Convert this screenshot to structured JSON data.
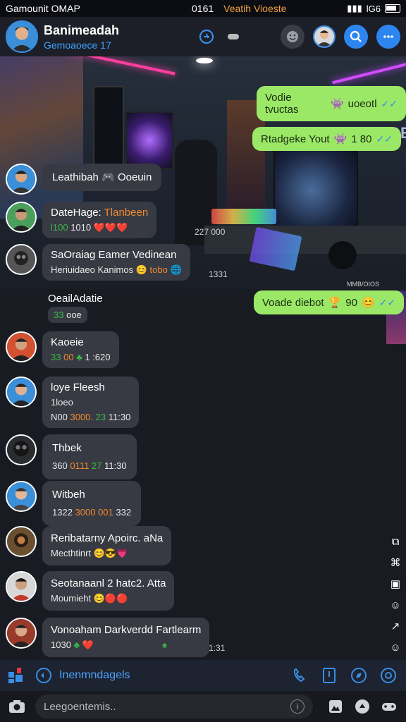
{
  "status_bar": {
    "carrier": "Gamounit OMAP",
    "time": "0161",
    "center_text": "Veatih Vioeste",
    "right_text": "lG6"
  },
  "header": {
    "name": "Banimeadah",
    "subtitle": "Gemoaoece 17"
  },
  "incoming": [
    {
      "title": "Leathibah",
      "title_tail": "Ooeuin",
      "line2": ""
    },
    {
      "title": "DateHage:",
      "title_tail": "Tlanbeen",
      "line2": "l​100",
      "line2_b": "1010",
      "ts": "227 000"
    },
    {
      "title": "SaOraiag Eamer Vedinean",
      "line2": "Heriuidaeo Kanimos",
      "line2_b": "tobo",
      "ts": "1331"
    },
    {
      "title": "OeailAdatie",
      "line2": "33",
      "line2_b": "ooe"
    },
    {
      "title": "Kaoeie",
      "line2": "33",
      "line2_b": "00",
      "line2_c": "1 :620"
    },
    {
      "title": "loye Fleesh",
      "line2": "1loeo",
      "line3": "N00",
      "line3_b": "3000.",
      "line3_c": "23",
      "line3_d": "11:30"
    },
    {
      "title": "Thbek",
      "line2": "360",
      "line2_b": "0111",
      "line2_c": "27",
      "line2_d": "11:30"
    },
    {
      "title": "Witbeh",
      "line2": "1322",
      "line2_b": "3000 001",
      "line2_c": "332"
    },
    {
      "title": "Reribatarny Apoirc. aNa",
      "line2": "Mecthtinrt"
    },
    {
      "title": "Seotanaanl 2 hatc2. Atta",
      "line2": "Moumieht"
    },
    {
      "title": "Vonoaham Darkverdd Fartlearm",
      "line2": "1030",
      "ts": "1:31"
    }
  ],
  "outgoing": [
    {
      "text": "Vodie tvuctas",
      "tail": "uoeotl"
    },
    {
      "text": "Rtadgeke Yout",
      "tail": "1 80"
    },
    {
      "text": "Voade diebot",
      "tail": "90"
    }
  ],
  "scene_tag": "IDE",
  "watermark": "MMB/OIOS",
  "bottom_label": "Inenmndagels",
  "input_placeholder": "Leegoentemis..",
  "colors": {
    "accent": "#2d86f0",
    "outgoing_bubble": "#9be867",
    "incoming_bubble": "#373a42"
  }
}
